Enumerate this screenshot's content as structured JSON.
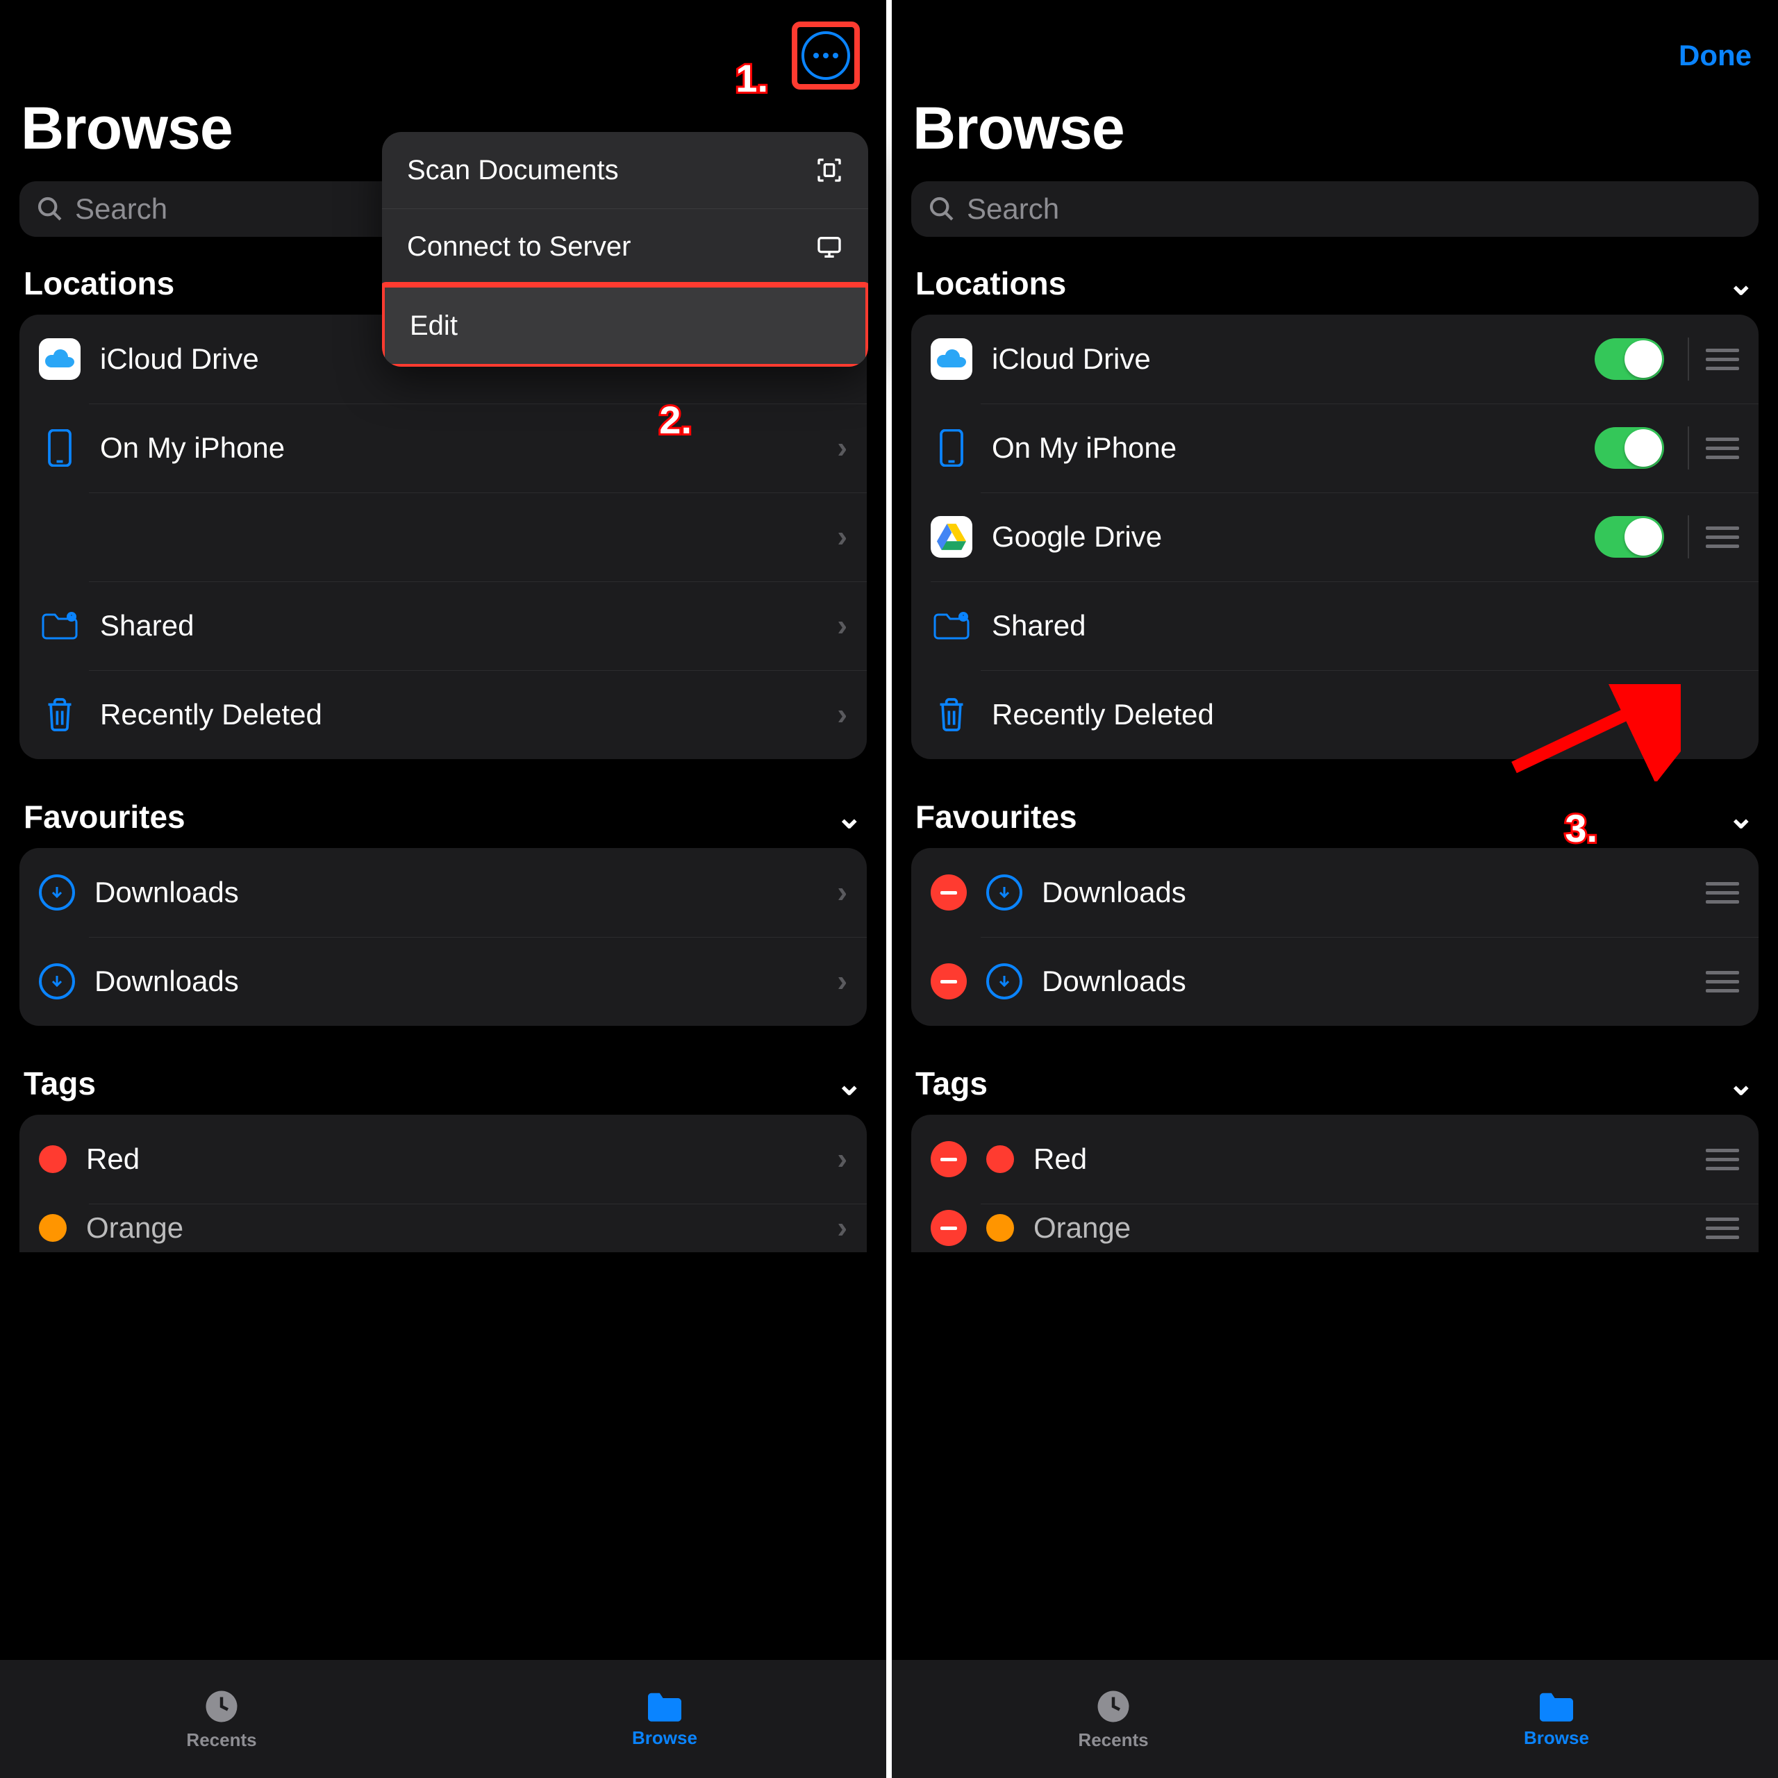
{
  "left": {
    "title": "Browse",
    "search_placeholder": "Search",
    "popup": {
      "scan": "Scan Documents",
      "connect": "Connect to Server",
      "edit": "Edit"
    },
    "sections": {
      "locations": {
        "label": "Locations",
        "items": [
          {
            "label": "iCloud Drive"
          },
          {
            "label": "On My iPhone"
          },
          {
            "label": ""
          },
          {
            "label": "Shared"
          },
          {
            "label": "Recently Deleted"
          }
        ]
      },
      "favourites": {
        "label": "Favourites",
        "items": [
          {
            "label": "Downloads"
          },
          {
            "label": "Downloads"
          }
        ]
      },
      "tags": {
        "label": "Tags",
        "items": [
          {
            "label": "Red",
            "color": "#ff3b30"
          },
          {
            "label": "Orange",
            "color": "#ff9500"
          }
        ]
      }
    },
    "steps": {
      "one": "1.",
      "two": "2."
    },
    "tabs": {
      "recents": "Recents",
      "browse": "Browse"
    }
  },
  "right": {
    "title": "Browse",
    "done": "Done",
    "search_placeholder": "Search",
    "sections": {
      "locations": {
        "label": "Locations",
        "items": [
          {
            "label": "iCloud Drive"
          },
          {
            "label": "On My iPhone"
          },
          {
            "label": "Google Drive"
          },
          {
            "label": "Shared"
          },
          {
            "label": "Recently Deleted"
          }
        ]
      },
      "favourites": {
        "label": "Favourites",
        "items": [
          {
            "label": "Downloads"
          },
          {
            "label": "Downloads"
          }
        ]
      },
      "tags": {
        "label": "Tags",
        "items": [
          {
            "label": "Red",
            "color": "#ff3b30"
          },
          {
            "label": "Orange",
            "color": "#ff9500"
          }
        ]
      }
    },
    "steps": {
      "three": "3."
    },
    "tabs": {
      "recents": "Recents",
      "browse": "Browse"
    }
  }
}
